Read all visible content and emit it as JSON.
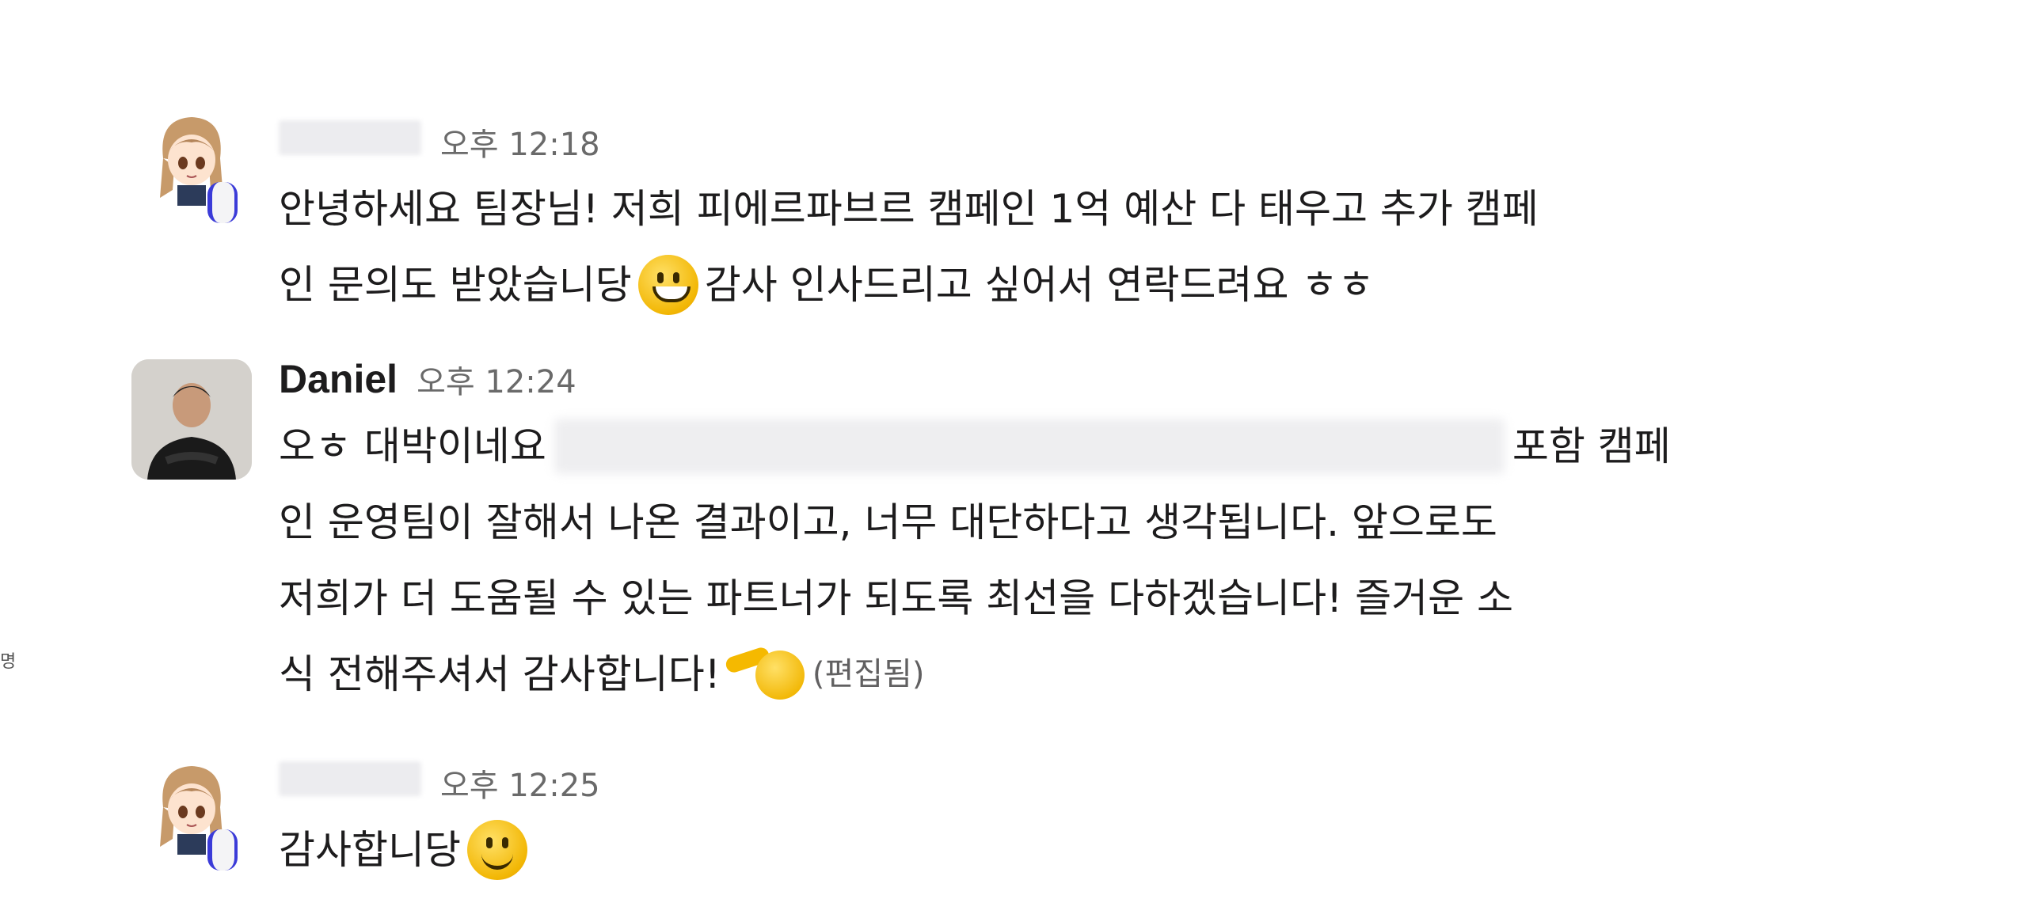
{
  "edge_glyph": "명",
  "messages": [
    {
      "sender": "",
      "time": "오후 12:18",
      "lines": [
        "안녕하세요 팀장님! 저희 피에르파브르 캠페인 1억 예산 다 태우고 추가 캠페",
        "인 문의도 받았습니당",
        "감사 인사드리고 싶어서 연락드려요 ㅎㅎ"
      ]
    },
    {
      "sender": "Daniel",
      "time": "오후 12:24",
      "lines": [
        "오ㅎ 대박이네요",
        "포함 캠페",
        "인 운영팀이 잘해서 나온 결과이고, 너무 대단하다고 생각됩니다. 앞으로도",
        "저희가 더 도움될 수 있는 파트너가 되도록 최선을 다하겠습니다! 즐거운 소",
        "식 전해주셔서 감사합니다!"
      ],
      "edited": "(편집됨)"
    },
    {
      "sender": "",
      "time": "오후 12:25",
      "lines": [
        "감사합니당"
      ]
    }
  ],
  "icons": {
    "grin": "grinning-face-icon",
    "salute": "saluting-face-icon",
    "smile": "slightly-smiling-face-icon"
  },
  "colors": {
    "status_ring": "#3b3bd8",
    "time": "#6a6a6a",
    "text": "#1d1c1d"
  }
}
